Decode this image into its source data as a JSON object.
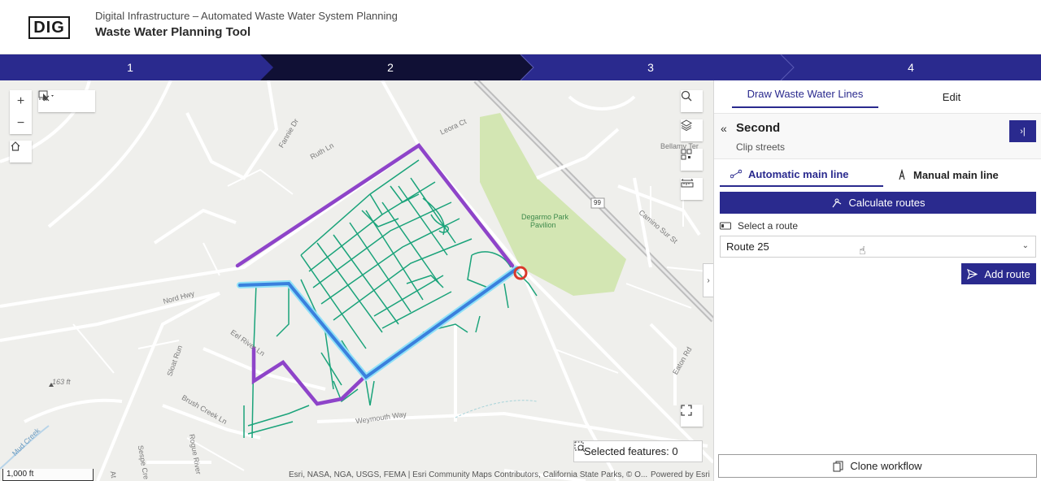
{
  "header": {
    "logo": "DIG",
    "subtitle": "Digital Infrastructure – Automated Waste Water System Planning",
    "title": "Waste Water Planning Tool"
  },
  "stepper": {
    "steps": [
      "1",
      "2",
      "3",
      "4"
    ],
    "active_index": 1,
    "colors": {
      "default": "#2a2a8e",
      "active": "#101035"
    }
  },
  "map": {
    "toolbar": {
      "zoom_in": "+",
      "zoom_out": "−",
      "home_icon": "home-icon",
      "select_icon": "select-cursor-icon",
      "clear_selection_icon": "clear-selection-icon"
    },
    "right_tools": [
      "search-icon",
      "layers-icon",
      "qr-icon",
      "measure-icon",
      "fullscreen-icon"
    ],
    "labels": {
      "leora_ct": "Leora Ct",
      "fannie_dr": "Fannie Dr",
      "ruth_ln": "Ruth Ln",
      "bellamy_ter": "Bellamy Ter",
      "park": "Degarmo Park",
      "pavilion": "Pavilion",
      "highway_shield": "99",
      "camino_sur_st": "Camino Sur St",
      "nord_hwy": "Nord Hwy",
      "eel_river_ln": "Eel River Ln",
      "sloat_run": "Sloat Run",
      "brush_creek_ln": "Brush Creek Ln",
      "weymouth_way": "Weymouth Way",
      "eaton_rd": "Eaton Rd",
      "elevation": "163 ft",
      "mud_creek": "Mud Creek",
      "sespe_cre": "Sespe Cre",
      "rogue_river": "Rogue River",
      "at": "At"
    },
    "scalebar": "1,000 ft",
    "attribution": "Esri, NASA, NGA, USGS, FEMA | Esri Community Maps Contributors, California State Parks, © O...",
    "powered_by": "Powered by Esri",
    "selected_features": "Selected features: 0",
    "line_colors": {
      "network": "#1aa37a",
      "route_purple": "#8e44c9",
      "route_blue": "#3a8fe0"
    }
  },
  "panel": {
    "tabs": [
      "Draw Waste Water Lines",
      "Edit"
    ],
    "step_title": "Second",
    "step_desc": "Clip streets",
    "subtabs": [
      "Automatic main line",
      "Manual main line"
    ],
    "calculate_label": "Calculate routes",
    "select_label": "Select a route",
    "selected_route": "Route 25",
    "add_route_label": "Add route",
    "clone_label": "Clone workflow"
  }
}
